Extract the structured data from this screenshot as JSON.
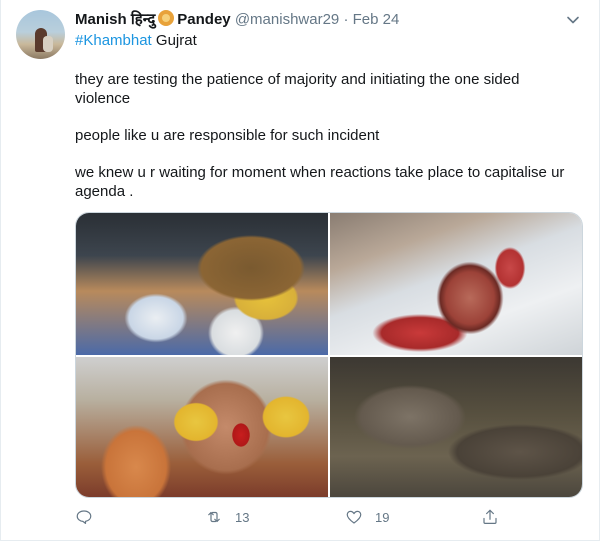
{
  "author": {
    "name_part1": "Manish हिन्दु",
    "name_part2": "Pandey",
    "handle": "@manishwar29",
    "separator": "·",
    "date": "Feb 24",
    "avatar_icon": "avatar",
    "badge_icon": "lion-face-icon"
  },
  "subline": {
    "hashtag": "#Khambhat",
    "location": "Gujrat"
  },
  "body": {
    "paragraphs": [
      "they are testing the patience of majority and initiating the one sided violence",
      "people like u are responsible for such incident",
      "we knew u r waiting for moment when reactions take place to capitalise ur agenda ."
    ]
  },
  "media": {
    "count": 4,
    "icons": [
      "photo",
      "photo",
      "photo",
      "photo"
    ]
  },
  "actions": {
    "reply_count": "",
    "retweet_count": "13",
    "like_count": "19",
    "icons": {
      "reply": "reply-icon",
      "retweet": "retweet-icon",
      "like": "heart-icon",
      "share": "share-icon",
      "menu": "chevron-down-icon"
    }
  },
  "colors": {
    "link": "#1b95e0",
    "muted": "#657786",
    "text": "#14171a",
    "border": "#ccd6dd"
  }
}
